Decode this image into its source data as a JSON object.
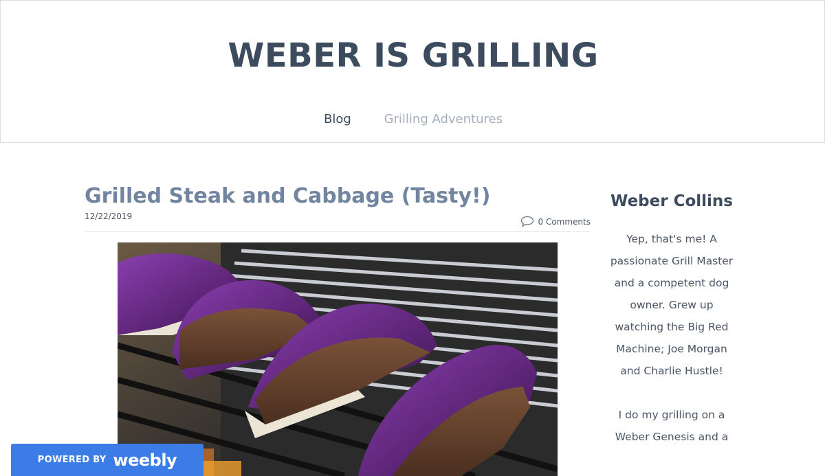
{
  "header": {
    "site_title": "WEBER IS GRILLING",
    "nav": [
      {
        "label": "Blog"
      },
      {
        "label": "Grilling Adventures"
      }
    ]
  },
  "post": {
    "title": "Grilled Steak and Cabbage (Tasty!)",
    "date": "12/22/2019",
    "comments": "0 Comments"
  },
  "sidebar": {
    "title": "Weber Collins",
    "paragraphs": [
      "Yep, that's me!  A passionate Grill Master and a competent dog owner.  Grew up watching the Big Red Machine; Joe Morgan and Charlie Hustle!",
      "I do my grilling on a Weber Genesis and a"
    ]
  },
  "badge": {
    "powered_by": "POWERED BY",
    "brand": "weebly"
  },
  "colors": {
    "title": "#3d4b5f",
    "post_title": "#7285a0",
    "nav_inactive": "#a7b0bd",
    "badge": "#3c7ce6"
  }
}
